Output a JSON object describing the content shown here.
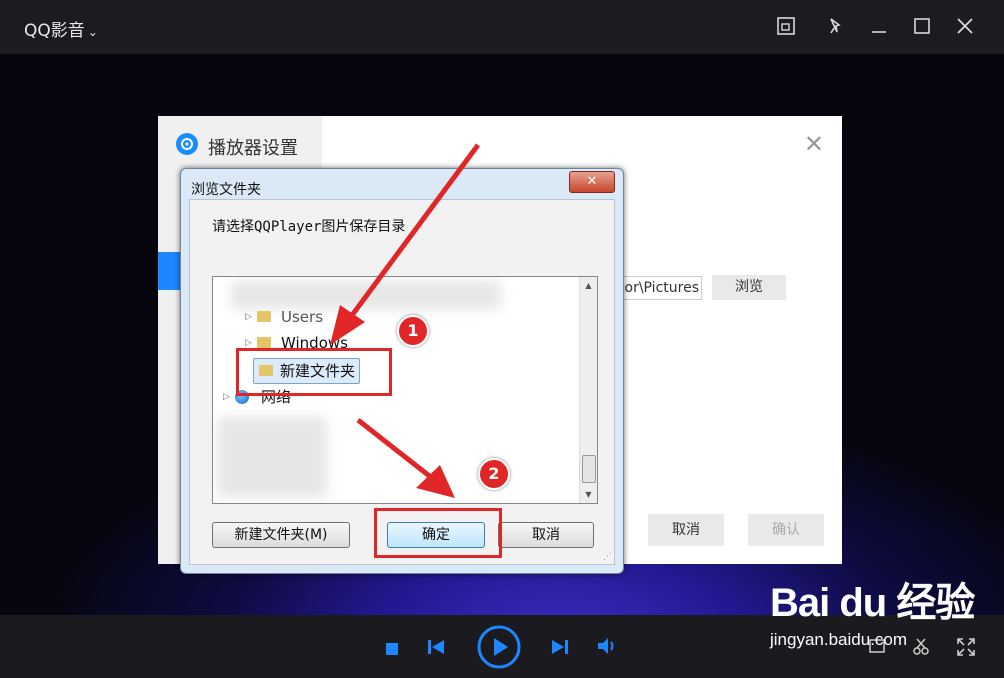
{
  "app": {
    "title": "QQ影音"
  },
  "settings": {
    "title": "播放器设置",
    "path_value": "C:\\Users\\Administrator\\Pictures",
    "browse_label": "浏览",
    "cancel_label": "取消",
    "confirm_label": "确认"
  },
  "dialog": {
    "title": "浏览文件夹",
    "prompt": "请选择QQPlayer图片保存目录",
    "tree": [
      {
        "label": "Users"
      },
      {
        "label": "Windows"
      },
      {
        "label": "新建文件夹",
        "selected": true
      },
      {
        "label": "网络"
      }
    ],
    "new_folder_label": "新建文件夹(M)",
    "ok_label": "确定",
    "cancel_label": "取消"
  },
  "annotations": {
    "step1": "1",
    "step2": "2"
  },
  "watermark": {
    "brand": "Bai du 经验",
    "url": "jingyan.baidu.com"
  },
  "colors": {
    "accent": "#1e86ff",
    "highlight": "#e02626"
  }
}
